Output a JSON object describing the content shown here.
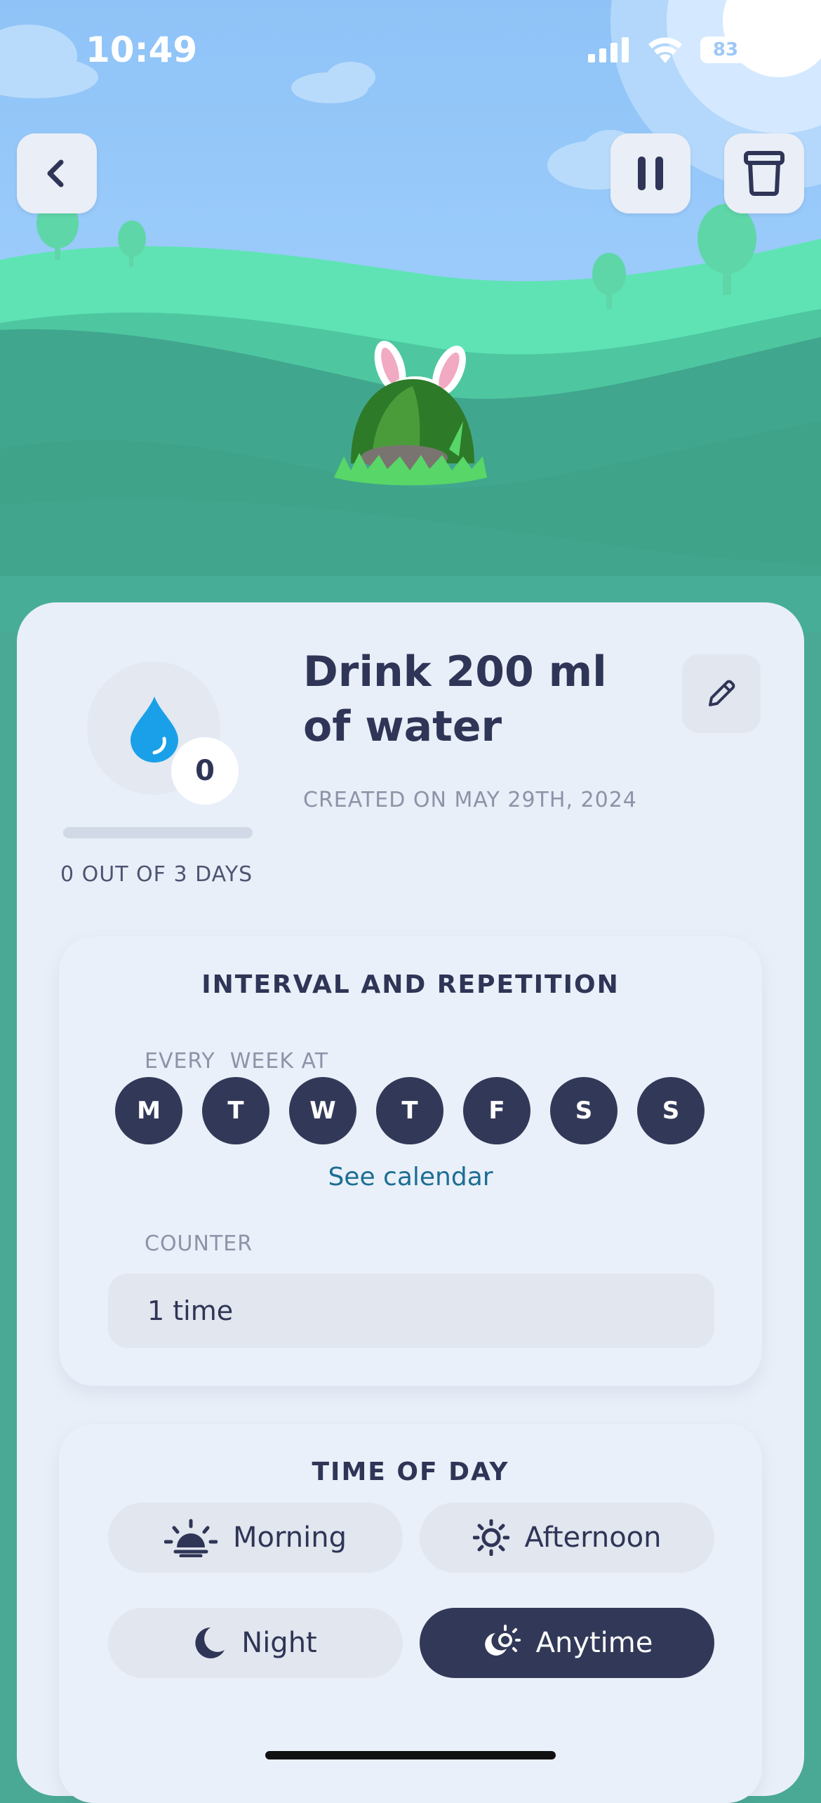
{
  "status_bar": {
    "time": "10:49",
    "battery": "83"
  },
  "nav": {
    "back": "chevron-left-icon",
    "pause": "pause-icon",
    "delete": "trash-icon"
  },
  "habit": {
    "title": "Drink 200 ml of water",
    "created": "CREATED ON MAY 29TH, 2024",
    "count": "0",
    "progress_label": "0 OUT OF 3 DAYS",
    "progress_fraction": 0,
    "icon": "water-drop-icon"
  },
  "interval": {
    "title": "INTERVAL AND REPETITION",
    "every_label": "EVERY  WEEK AT",
    "days": [
      "M",
      "T",
      "W",
      "T",
      "F",
      "S",
      "S"
    ],
    "see_calendar": "See calendar",
    "counter_label": "COUNTER",
    "counter_value": "1 time"
  },
  "time_of_day": {
    "title": "TIME OF DAY",
    "options": [
      {
        "label": "Morning",
        "icon": "sunrise-icon",
        "selected": false
      },
      {
        "label": "Afternoon",
        "icon": "sun-icon",
        "selected": false
      },
      {
        "label": "Night",
        "icon": "moon-icon",
        "selected": false
      },
      {
        "label": "Anytime",
        "icon": "sun-moon-icon",
        "selected": true
      }
    ]
  },
  "colors": {
    "accent": "#323958",
    "link": "#1d6e93",
    "card": "#e9eff8"
  }
}
